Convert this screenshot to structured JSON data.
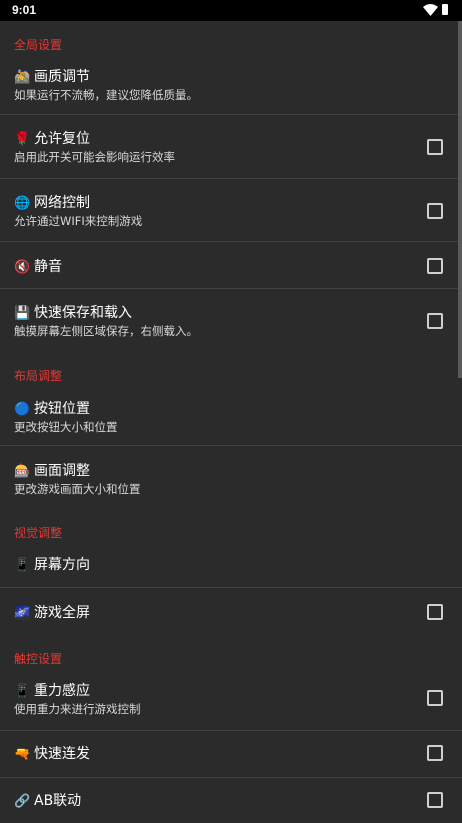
{
  "status_bar": {
    "time": "9:01"
  },
  "sections": {
    "global": "全局设置",
    "layout": "布局调整",
    "view": "视觉调整",
    "touch": "触控设置"
  },
  "settings": {
    "quality": {
      "icon": "🚵",
      "title": "画质调节",
      "summary": "如果运行不流畅，建议您降低质量。"
    },
    "reset": {
      "icon": "🌹",
      "title": "允许复位",
      "summary": "启用此开关可能会影响运行效率",
      "checked": false
    },
    "network": {
      "icon": "🌐",
      "title": "网络控制",
      "summary": "允许通过WIFI来控制游戏",
      "checked": false
    },
    "mute": {
      "icon": "🔇",
      "title": "静音",
      "checked": false
    },
    "quicksave": {
      "icon": "💾",
      "title": "快速保存和载入",
      "summary": "触摸屏幕左侧区域保存，右侧载入。",
      "checked": false
    },
    "button_pos": {
      "icon": "🔵",
      "title": "按钮位置",
      "summary": "更改按钮大小和位置"
    },
    "screen_adjust": {
      "icon": "🎰",
      "title": "画面调整",
      "summary": "更改游戏画面大小和位置"
    },
    "orientation": {
      "icon": "📱",
      "title": "屏幕方向"
    },
    "fullscreen": {
      "icon": "🌌",
      "title": "游戏全屏",
      "checked": false
    },
    "gravity": {
      "icon": "📱",
      "title": "重力感应",
      "summary": "使用重力来进行游戏控制",
      "checked": false
    },
    "turbo": {
      "icon": "🔫",
      "title": "快速连发",
      "checked": false
    },
    "ab_link": {
      "icon": "🔗",
      "title": "AB联动",
      "checked": false
    }
  }
}
